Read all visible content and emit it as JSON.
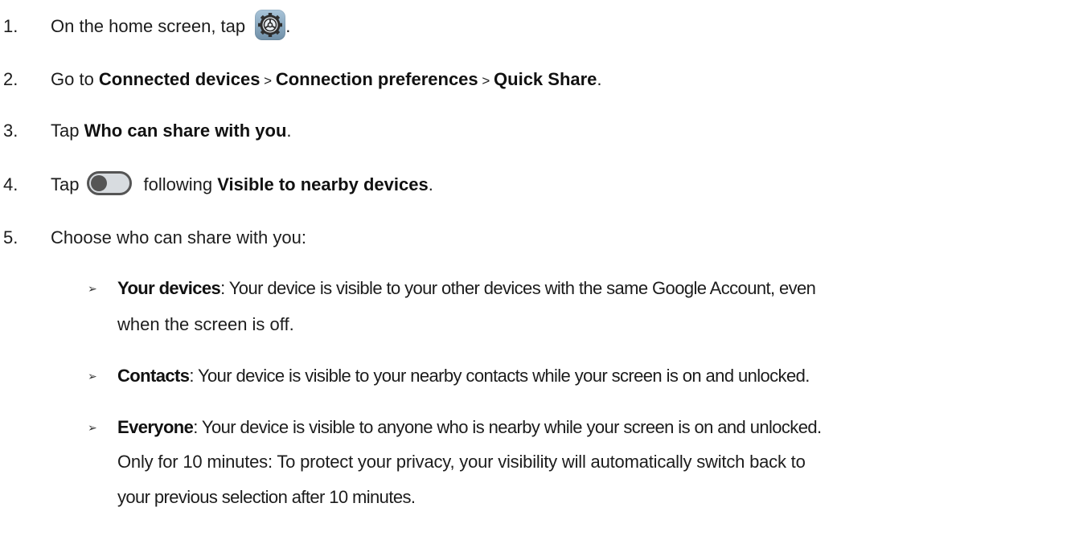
{
  "steps": [
    {
      "number": "1.",
      "text_before": "On the home screen, tap",
      "icon": "settings-gear-icon",
      "text_after": "."
    },
    {
      "number": "2.",
      "prefix": "Go to ",
      "path": [
        "Connected devices",
        "Connection preferences",
        "Quick Share"
      ],
      "separator": " > ",
      "suffix": "."
    },
    {
      "number": "3.",
      "prefix": "Tap ",
      "bold": "Who can share with you",
      "suffix": "."
    },
    {
      "number": "4.",
      "prefix": "Tap",
      "icon": "toggle-switch-off-icon",
      "middle": "following ",
      "bold": "Visible to nearby devices",
      "suffix": "."
    },
    {
      "number": "5.",
      "text": "Choose who can share with you:"
    }
  ],
  "options": [
    {
      "marker": "➢",
      "title": "Your devices",
      "description": ": Your device is visible to your other devices with the same Google Account, even",
      "continuation": "when the screen is off."
    },
    {
      "marker": "➢",
      "title": "Contacts",
      "description": ": Your device is visible to your nearby contacts while your screen is on and unlocked."
    },
    {
      "marker": "➢",
      "title": "Everyone",
      "description": ": Your device is visible to anyone who is nearby while your screen is on and unlocked.",
      "note_line1": "Only for 10 minutes: To protect your privacy, your visibility will automatically switch back to",
      "note_line2": "your previous selection after 10 minutes."
    }
  ],
  "colors": {
    "text": "#1c1c1c",
    "gear_icon_bg": "#8fabc1",
    "toggle_track": "#d8dce0",
    "toggle_outline": "#555555"
  }
}
